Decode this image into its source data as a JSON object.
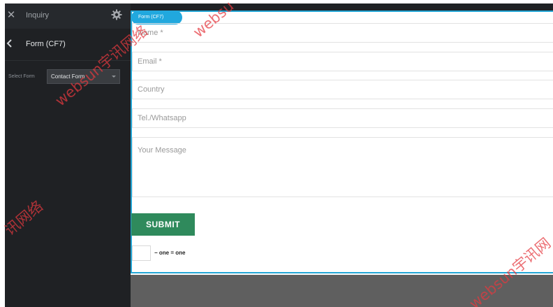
{
  "panel": {
    "title": "Inquiry",
    "sub_title": "Form (CF7)",
    "select_label": "Select Form",
    "select_value": "Contact Form"
  },
  "preview": {
    "badge": "Form (CF7)",
    "fields": {
      "name": "Name *",
      "email": "Email *",
      "country": "Country",
      "tel": "Tel./Whatsapp",
      "message": "Your Message"
    },
    "submit_label": "SUBMIT",
    "captcha_text": "− one = one"
  },
  "watermark": {
    "text_a": "websun宇讯网络",
    "text_b": "websun宇讯网络",
    "text_c": "讯网络",
    "text_d": "websun宇讯网",
    "text_e": "websu"
  },
  "colors": {
    "panel_bg": "#1f2124",
    "accent_blue": "#21a8de",
    "submit_green": "#2f8a5c",
    "watermark_red": "#e5393f",
    "footer_gray": "#5f5f5f"
  },
  "icons": [
    "close-icon",
    "gear-icon",
    "back-arrow-icon",
    "chevron-down-icon"
  ]
}
